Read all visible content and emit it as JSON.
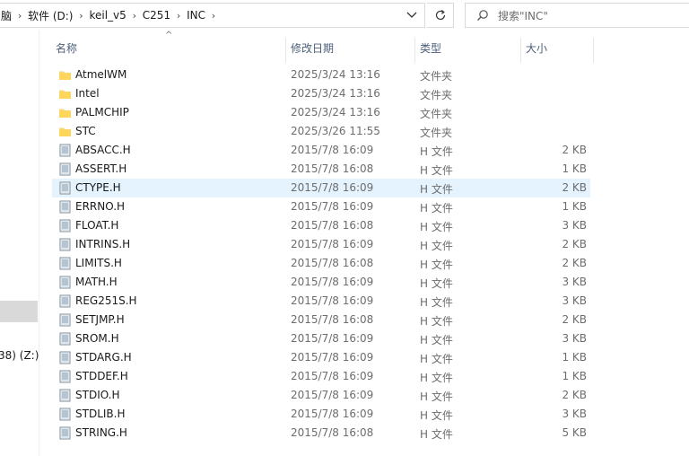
{
  "breadcrumb": [
    "脑",
    "软件 (D:)",
    "keil_v5",
    "C251",
    "INC"
  ],
  "search": {
    "placeholder": "搜索\"INC\""
  },
  "nav": {
    "drive_label": "38) (Z:)"
  },
  "columns": {
    "name": "名称",
    "date": "修改日期",
    "type": "类型",
    "size": "大小"
  },
  "sort_indicator": "^",
  "colors": {
    "folder": "#f8d775",
    "selected_row": "#e5f3ff",
    "header_text": "#4c607a"
  },
  "rows": [
    {
      "name": "AtmelWM",
      "date": "2025/3/24 13:16",
      "type": "文件夹",
      "size": "",
      "icon": "folder-icon"
    },
    {
      "name": "Intel",
      "date": "2025/3/24 13:16",
      "type": "文件夹",
      "size": "",
      "icon": "folder-icon"
    },
    {
      "name": "PALMCHIP",
      "date": "2025/3/24 13:16",
      "type": "文件夹",
      "size": "",
      "icon": "folder-icon"
    },
    {
      "name": "STC",
      "date": "2025/3/26 11:55",
      "type": "文件夹",
      "size": "",
      "icon": "folder-icon"
    },
    {
      "name": "ABSACC.H",
      "date": "2015/7/8 16:09",
      "type": "H 文件",
      "size": "2 KB",
      "icon": "file-icon"
    },
    {
      "name": "ASSERT.H",
      "date": "2015/7/8 16:08",
      "type": "H 文件",
      "size": "1 KB",
      "icon": "file-icon"
    },
    {
      "name": "CTYPE.H",
      "date": "2015/7/8 16:09",
      "type": "H 文件",
      "size": "2 KB",
      "icon": "file-icon",
      "selected": true
    },
    {
      "name": "ERRNO.H",
      "date": "2015/7/8 16:09",
      "type": "H 文件",
      "size": "1 KB",
      "icon": "file-icon"
    },
    {
      "name": "FLOAT.H",
      "date": "2015/7/8 16:08",
      "type": "H 文件",
      "size": "3 KB",
      "icon": "file-icon"
    },
    {
      "name": "INTRINS.H",
      "date": "2015/7/8 16:09",
      "type": "H 文件",
      "size": "2 KB",
      "icon": "file-icon"
    },
    {
      "name": "LIMITS.H",
      "date": "2015/7/8 16:08",
      "type": "H 文件",
      "size": "2 KB",
      "icon": "file-icon"
    },
    {
      "name": "MATH.H",
      "date": "2015/7/8 16:09",
      "type": "H 文件",
      "size": "3 KB",
      "icon": "file-icon"
    },
    {
      "name": "REG251S.H",
      "date": "2015/7/8 16:09",
      "type": "H 文件",
      "size": "3 KB",
      "icon": "file-icon"
    },
    {
      "name": "SETJMP.H",
      "date": "2015/7/8 16:08",
      "type": "H 文件",
      "size": "2 KB",
      "icon": "file-icon"
    },
    {
      "name": "SROM.H",
      "date": "2015/7/8 16:09",
      "type": "H 文件",
      "size": "3 KB",
      "icon": "file-icon"
    },
    {
      "name": "STDARG.H",
      "date": "2015/7/8 16:09",
      "type": "H 文件",
      "size": "1 KB",
      "icon": "file-icon"
    },
    {
      "name": "STDDEF.H",
      "date": "2015/7/8 16:09",
      "type": "H 文件",
      "size": "1 KB",
      "icon": "file-icon"
    },
    {
      "name": "STDIO.H",
      "date": "2015/7/8 16:09",
      "type": "H 文件",
      "size": "2 KB",
      "icon": "file-icon"
    },
    {
      "name": "STDLIB.H",
      "date": "2015/7/8 16:09",
      "type": "H 文件",
      "size": "3 KB",
      "icon": "file-icon"
    },
    {
      "name": "STRING.H",
      "date": "2015/7/8 16:08",
      "type": "H 文件",
      "size": "5 KB",
      "icon": "file-icon"
    }
  ]
}
